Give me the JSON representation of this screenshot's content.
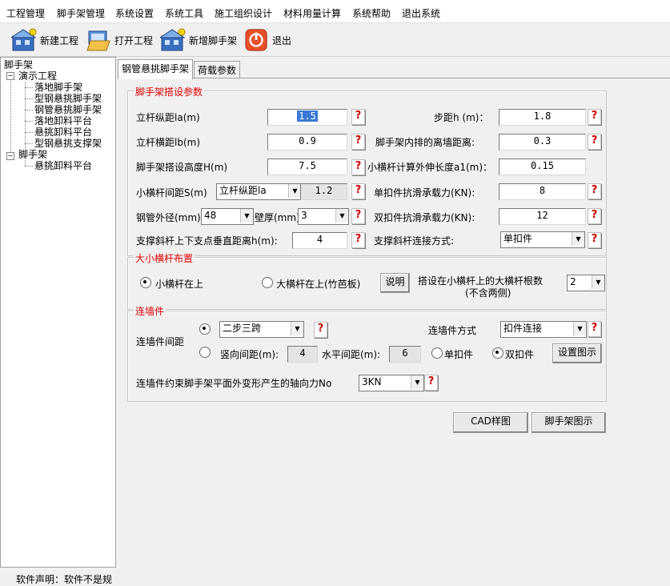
{
  "menu": [
    "工程管理",
    "脚手架管理",
    "系统设置",
    "系统工具",
    "施工组织设计",
    "材料用量计算",
    "系统帮助",
    "退出系统"
  ],
  "toolbar": {
    "new_project": "新建工程",
    "open_project": "打开工程",
    "add_scaffold": "新增脚手架",
    "exit": "退出"
  },
  "tree": {
    "root": "脚手架",
    "project1": "演示工程",
    "project1_items": [
      "落地脚手架",
      "型钢悬挑脚手架",
      "钢管悬挑脚手架",
      "落地卸料平台",
      "悬挑卸料平台",
      "型钢悬挑支撑架"
    ],
    "project2": "脚手架",
    "project2_items": [
      "悬挑卸料平台"
    ]
  },
  "status": "软件声明：软件不是规",
  "tabs": [
    "钢管悬挑脚手架",
    "荷载参数"
  ],
  "section_setup": {
    "title": "脚手架搭设参数",
    "la_label": "立杆纵距la(m)",
    "la_value": "1.5",
    "h_label": "步距h (m)：",
    "h_value": "1.8",
    "lb_label": "立杆横距lb(m)",
    "lb_value": "0.9",
    "wall_dist_label": "脚手架内排的离墙距离:",
    "wall_dist_value": "0.3",
    "H_label": "脚手架搭设高度H(m)",
    "H_value": "7.5",
    "a1_label": "小横杆计算外伸长度a1(m)：",
    "a1_value": "0.15",
    "S_label": "小横杆间距S(m)",
    "S_combo": "立杆纵距la",
    "S_value": "1.2",
    "single_label": "单扣件抗滑承载力(KN):",
    "single_value": "8",
    "dia_label": "钢管外径(mm)",
    "dia_value": "48",
    "thick_label": "壁厚(mm)",
    "thick_value": "3",
    "double_label": "双扣件抗滑承载力(KN):",
    "double_value": "12",
    "brace_h_label": "支撑斜杆上下支点垂直距离h(m):",
    "brace_h_value": "4",
    "brace_conn_label": "支撑斜杆连接方式:",
    "brace_conn_value": "单扣件"
  },
  "section_bars": {
    "title": "大小横杆布置",
    "opt_small_top": "小横杆在上",
    "opt_large_top": "大横杆在上(竹芭板)",
    "explain_button": "说明",
    "count_label_1": "搭设在小横杆上的大横杆根数",
    "count_label_2": "(不含两侧)",
    "count_value": "2"
  },
  "section_wall": {
    "title": "连墙件",
    "spacing_label": "连墙件间距",
    "pattern_value": "二步三跨",
    "mode_label": "连墙件方式",
    "mode_value": "扣件连接",
    "vert_label": "竖向间距(m):",
    "vert_value": "4",
    "horiz_label": "水平间距(m):",
    "horiz_value": "6",
    "opt_single": "单扣件",
    "opt_double": "双扣件",
    "diagram_button": "设置图示",
    "axial_label": "连墙件约束脚手架平面外变形产生的轴向力No",
    "axial_value": "3KN"
  },
  "bottom_buttons": {
    "cad": "CAD样图",
    "scaffold_diagram": "脚手架图示"
  },
  "help_glyph": "?"
}
